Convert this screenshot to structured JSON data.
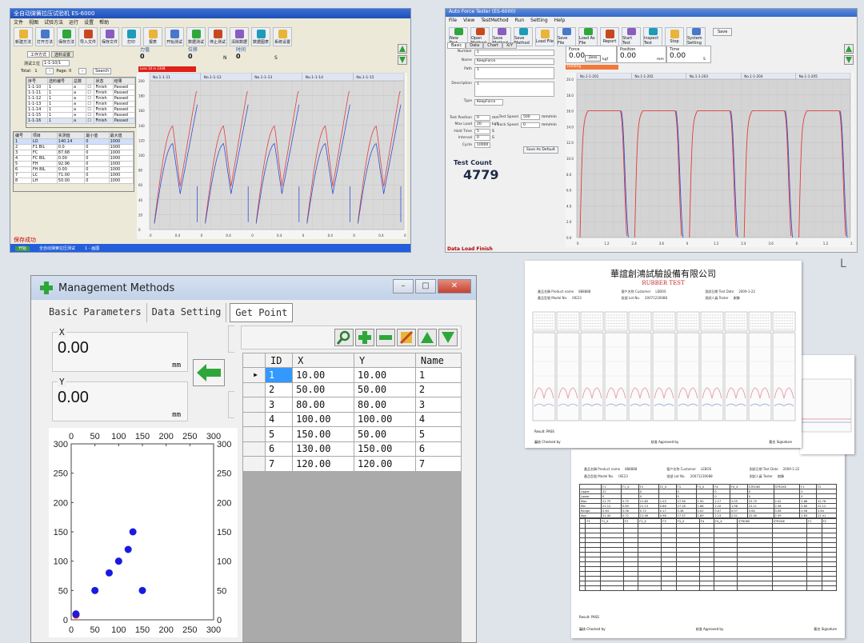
{
  "p1": {
    "title": "全自动弹簧拉压试验机 ES-6000",
    "menu": [
      "文件",
      "视图",
      "试验方法",
      "运行",
      "设置",
      "帮助"
    ],
    "toolbar": [
      "新建方法",
      "打开方法",
      "保存方法",
      "导入文件",
      "保存文件",
      "打印",
      "报表",
      "开始测试",
      "数据测试",
      "停止测试",
      "清除数据",
      "数据图表",
      "系统设置"
    ],
    "tabs": [
      "工作方式",
      "选料设置"
    ],
    "spec_label": "测试工位",
    "spec_value": "1-1-10/1",
    "total_label": "Total:",
    "total_value": "1",
    "page_label": "Page:",
    "page_value": "0",
    "search": "Search",
    "list_headers": [
      "序号",
      "选料编号",
      "总数",
      "",
      "状态",
      "结果"
    ],
    "list_rows": [
      [
        "1-1-10",
        "1",
        "a",
        "Finish",
        "Passed"
      ],
      [
        "1-1-11",
        "1",
        "a",
        "Finish",
        "Passed"
      ],
      [
        "1-1-12",
        "1",
        "a",
        "Finish",
        "Passed"
      ],
      [
        "1-1-13",
        "1",
        "a",
        "Finish",
        "Passed"
      ],
      [
        "1-1-14",
        "1",
        "a",
        "Finish",
        "Passed"
      ],
      [
        "1-1-15",
        "1",
        "a",
        "Finish",
        "Passed"
      ],
      [
        "1-1-16",
        "1",
        "a",
        "Finish",
        "Passed"
      ]
    ],
    "param_headers": [
      "编号",
      "项目",
      "实测值",
      "最小值",
      "最大值"
    ],
    "param_rows": [
      [
        "1",
        "LO",
        "140.14",
        "0",
        "1000"
      ],
      [
        "2",
        "F1 BIL",
        "0.0",
        "0",
        "1000"
      ],
      [
        "3",
        "FC",
        "87.68",
        "0",
        "1000"
      ],
      [
        "4",
        "FC BIL",
        "0.00",
        "0",
        "1000"
      ],
      [
        "5",
        "FH",
        "92.96",
        "0",
        "1000"
      ],
      [
        "6",
        "FH BIL",
        "0.00",
        "0",
        "1000"
      ],
      [
        "7",
        "LC",
        "71.00",
        "0",
        "1000"
      ],
      [
        "8",
        "LH",
        "50.00",
        "0",
        "1000"
      ]
    ],
    "readouts": [
      {
        "label": "力值",
        "value": "0"
      },
      {
        "label": "位移",
        "value": "0",
        "unit": "N"
      },
      {
        "label": "时间",
        "value": "0",
        "unit": "S"
      }
    ],
    "alert": "Loss 10 in 2308",
    "chart_headers": [
      "No.1-1-11",
      "No.1-1-12",
      "No.1-1-13",
      "No.1-1-14",
      "No.1-1-15"
    ],
    "status": "保存成功",
    "taskbar_items": [
      "开始",
      "全自动弹簧拉压测试",
      "1 - 画图"
    ]
  },
  "p2": {
    "title": "Auto Force Tester (ES-6000)",
    "menu": [
      "File",
      "View",
      "TestMethod",
      "Run",
      "Setting",
      "Help"
    ],
    "toolbar": [
      "New Test",
      "Open Method",
      "Save Method",
      "Save Method",
      "Load File",
      "Save File",
      "Load As File",
      "Report",
      "Start Test",
      "Inspect Test",
      "Stop",
      "System Setting"
    ],
    "save_button": "Save",
    "tabs": [
      "Basic",
      "Data",
      "Chart",
      "X/Y"
    ],
    "fields": [
      {
        "label": "Number",
        "value": "1"
      },
      {
        "label": "Name",
        "value": "KeepForce"
      },
      {
        "label": "Path",
        "value": "1"
      },
      {
        "label": "Description",
        "value": "1"
      },
      {
        "label": "Type",
        "value": "KeepForce"
      }
    ],
    "test_fields": [
      {
        "label": "Test Position",
        "value": "0",
        "unit": "mm"
      },
      {
        "label": "Max Load",
        "value": "20",
        "unit": "kgf"
      },
      {
        "label": "Hold Time",
        "value": "5",
        "unit": "S"
      },
      {
        "label": "Interval",
        "value": "0",
        "unit": "S"
      },
      {
        "label": "Cycle",
        "value": "10000"
      }
    ],
    "speed_fields": [
      {
        "label": "Test Speed",
        "value": "500",
        "unit": "mm/min"
      },
      {
        "label": "Back Speed",
        "value": "0",
        "unit": "mm/min"
      }
    ],
    "save_default": "Save As Default",
    "count_label": "Test Count",
    "count_value": "4779",
    "readouts": [
      {
        "label": "Force",
        "value": "0.00",
        "unit": "kgf"
      },
      {
        "label": "Position",
        "value": "0.00",
        "unit": "mm"
      },
      {
        "label": "Time",
        "value": "0.00",
        "unit": "S"
      }
    ],
    "zero_button": "Zero",
    "holding": "Holding",
    "chart_headers": [
      "No.1-1-201",
      "No.1-1-202",
      "No.1-1-203",
      "No.1-1-204",
      "No.1-1-205"
    ],
    "status": "Data Load Finish"
  },
  "p3": {
    "title": "Management Methods",
    "tabs": [
      "Basic Parameters",
      "Data Setting",
      "Get Point"
    ],
    "x_label": "X",
    "x_value": "0.00",
    "x_unit": "mm",
    "y_label": "Y",
    "y_value": "0.00",
    "y_unit": "mm",
    "columns": [
      "ID",
      "X",
      "Y",
      "Name"
    ],
    "rows": [
      {
        "id": "1",
        "x": "10.00",
        "y": "10.00",
        "name": "1"
      },
      {
        "id": "2",
        "x": "50.00",
        "y": "50.00",
        "name": "2"
      },
      {
        "id": "3",
        "x": "80.00",
        "y": "80.00",
        "name": "3"
      },
      {
        "id": "4",
        "x": "100.00",
        "y": "100.00",
        "name": "4"
      },
      {
        "id": "5",
        "x": "150.00",
        "y": "50.00",
        "name": "5"
      },
      {
        "id": "6",
        "x": "130.00",
        "y": "150.00",
        "name": "6"
      },
      {
        "id": "7",
        "x": "120.00",
        "y": "120.00",
        "name": "7"
      }
    ],
    "scatter_ticks": [
      "0",
      "50",
      "100",
      "150",
      "200",
      "250",
      "300"
    ]
  },
  "p4": {
    "title": "華誼創鴻試驗設備有限公司",
    "subtitle": "RUBBER TEST",
    "meta": [
      {
        "label": "產品名稱 Product name",
        "value": "888888"
      },
      {
        "label": "客户名称 Customer",
        "value": "LEBOS"
      },
      {
        "label": "測試日期 Test Date",
        "value": "2009-1-22"
      },
      {
        "label": "產品型號 Model No.",
        "value": "IXE23"
      },
      {
        "label": "批號 Lot No.",
        "value": "20071230088"
      },
      {
        "label": "測試人員 Tester",
        "value": "謝鋒"
      }
    ],
    "result": "Result: PASS",
    "footer": [
      "審核 Checked by",
      "核准 Approved by",
      "簽名 Signature"
    ]
  },
  "p5": {
    "meta": [
      {
        "label": "產品名稱 Product name",
        "value": "888888"
      },
      {
        "label": "客户名称 Customer",
        "value": "LEBOS"
      },
      {
        "label": "測試日期 Test Date",
        "value": "2009-1-22"
      },
      {
        "label": "產品型號 Model No.",
        "value": "IXE23"
      },
      {
        "label": "批號 Lot No.",
        "value": "20071230088"
      },
      {
        "label": "測試人員 Tester",
        "value": "謝鋒"
      }
    ],
    "col_headers": [
      "",
      "F1",
      "F1_X",
      "F2",
      "F2_X",
      "F3",
      "F3_X",
      "F4",
      "F4_X",
      "STROKE",
      "STROKE",
      "F1",
      "F2"
    ],
    "summary_rows": [
      [
        "Upper",
        "22",
        "",
        "0",
        "",
        "0",
        "",
        "0",
        "",
        "0",
        "",
        "0",
        ""
      ],
      [
        "Lower",
        "0",
        "",
        "0",
        "",
        "0",
        "",
        "0",
        "",
        "0",
        "",
        "0",
        ""
      ],
      [
        "Max",
        "21.75",
        "0.75",
        "21.85",
        "1.03",
        "27.56",
        "1.90",
        "2.17",
        "2.05",
        "22.75",
        "2.42",
        "2.66",
        "22.76"
      ],
      [
        "Min",
        "21.12",
        "0.69",
        "21.13",
        "0.86",
        "27.18",
        "1.88",
        "2.10",
        "1.98",
        "22.11",
        "2.36",
        "2.60",
        "22.12"
      ],
      [
        "Range",
        "0.63",
        "0.06",
        "0.72",
        "0.17",
        "0.38",
        "0.02",
        "0.07",
        "0.07",
        "0.64",
        "0.06",
        "0.06",
        "0.64"
      ],
      [
        "Avg",
        "21.40",
        "0.72",
        "21.46",
        "0.96",
        "27.37",
        "1.89",
        "2.13",
        "2.01",
        "22.40",
        "2.39",
        "2.63",
        "22.41"
      ]
    ],
    "result": "Result: PASS",
    "footer": [
      "審核 Checked by",
      "核准 Approved by",
      "簽名 Signature"
    ]
  }
}
